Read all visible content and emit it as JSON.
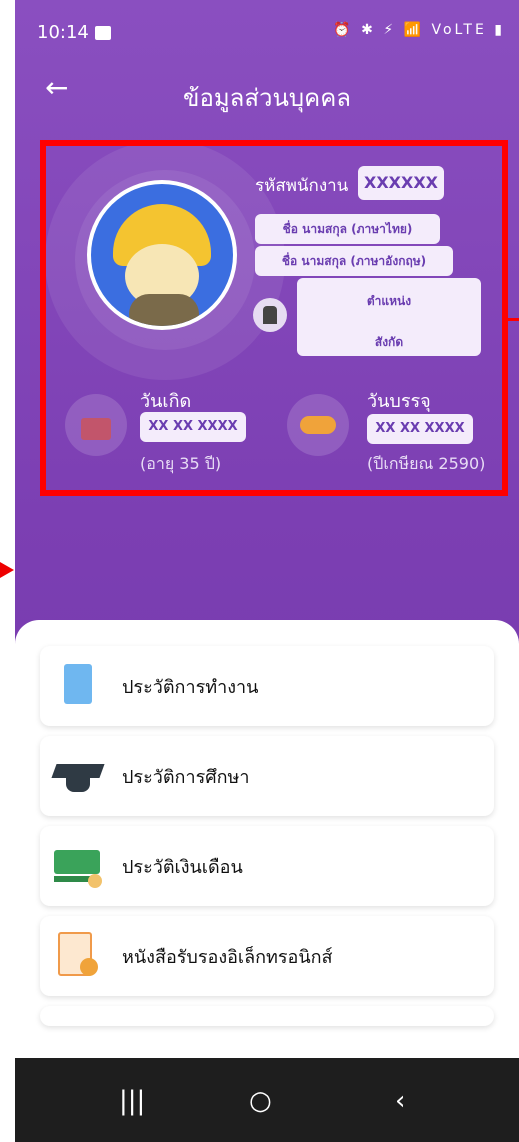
{
  "status_bar": {
    "time": "10:14",
    "icons": "⏰ ✱ ⚡ 📶 VoLTE ▮"
  },
  "header": {
    "back_label": "←",
    "title": "ข้อมูลส่วนบุคคล"
  },
  "profile": {
    "employee_id_label": "รหัสพนักงาน",
    "employee_id_value": "XXXXXX",
    "name_thai": "ชื่อ นามสกุล (ภาษาไทย)",
    "name_english": "ชื่อ นามสกุล (ภาษาอังกฤษ)",
    "position": "ตำแหน่ง",
    "affiliation": "สังกัด",
    "birth_label": "วันเกิด",
    "birth_value": "XX XX XXXX",
    "age_text": "(อายุ 35 ปี)",
    "hire_label": "วันบรรจุ",
    "hire_value": "XX XX XXXX",
    "retire_text": "(ปีเกษียณ 2590)"
  },
  "menu": {
    "items": [
      {
        "label": "ประวัติการทำงาน"
      },
      {
        "label": "ประวัติการศึกษา"
      },
      {
        "label": "ประวัติเงินเดือน"
      },
      {
        "label": "หนังสือรับรองอิเล็กทรอนิกส์"
      }
    ]
  },
  "nav": {
    "recents": "|||",
    "home": "○",
    "back": "‹"
  },
  "colors": {
    "purple": "#7c3fb3",
    "highlight": "#ff0000",
    "pill_text": "#6a3db0"
  }
}
